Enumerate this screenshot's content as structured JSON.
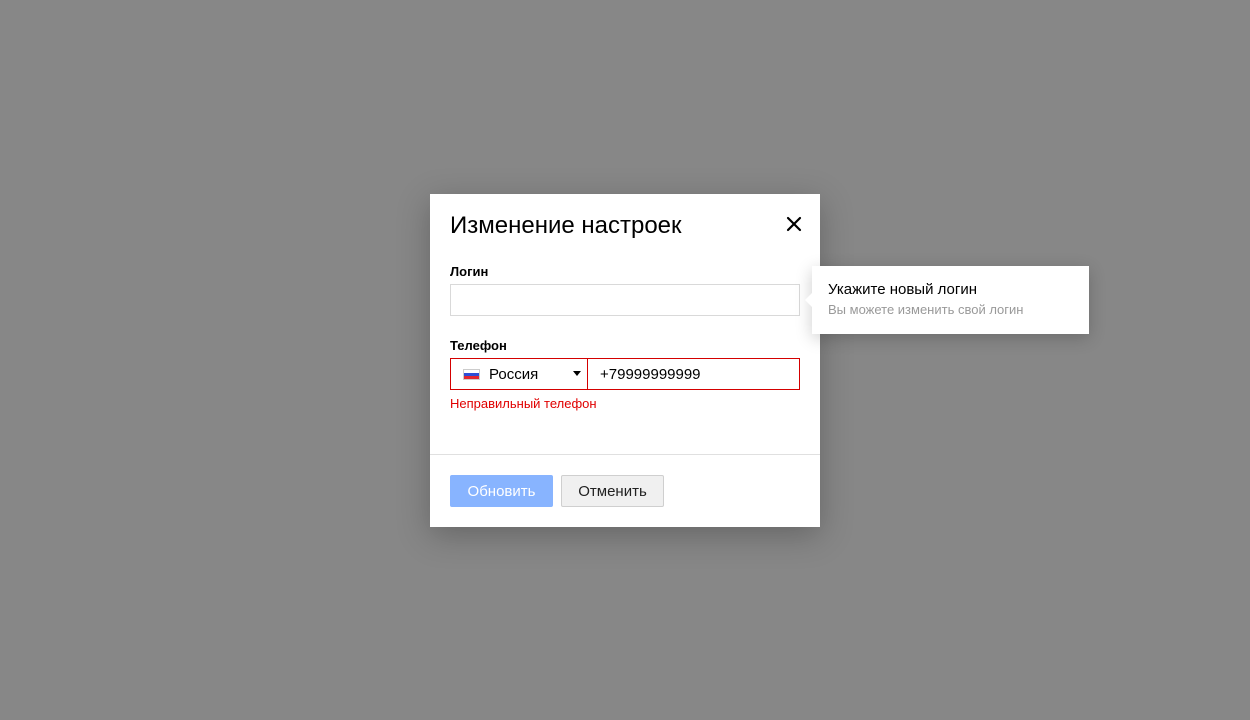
{
  "modal": {
    "title": "Изменение настроек",
    "close_icon": "close-icon"
  },
  "login": {
    "label": "Логин",
    "value": "",
    "placeholder": ""
  },
  "phone": {
    "label": "Телефон",
    "country": "Россия",
    "country_flag": "russia-flag-icon",
    "number": "+79999999999",
    "error": "Неправильный телефон"
  },
  "actions": {
    "update_label": "Обновить",
    "cancel_label": "Отменить"
  },
  "tooltip": {
    "title": "Укажите новый логин",
    "subtitle": "Вы можете изменить свой логин"
  },
  "colors": {
    "backdrop": "#878787",
    "error": "#e00000",
    "primary_button": "#88b4ff"
  }
}
